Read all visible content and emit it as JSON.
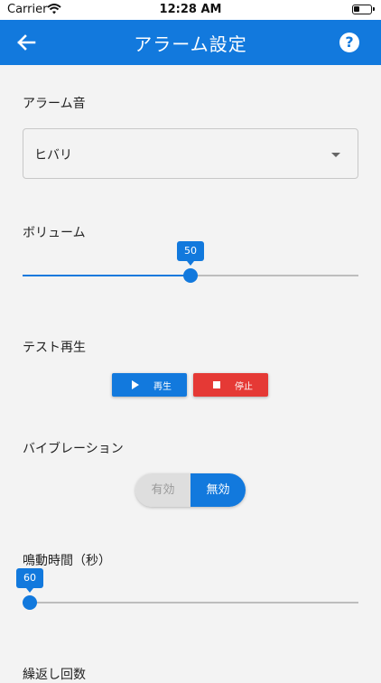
{
  "status_bar": {
    "carrier": "Carrier",
    "time": "12:28 AM"
  },
  "app_bar": {
    "title": "アラーム設定",
    "help": "?"
  },
  "alarm_sound": {
    "label": "アラーム音",
    "value": "ヒバリ"
  },
  "volume": {
    "label": "ボリューム",
    "value": 50,
    "value_text": "50",
    "min": 0,
    "max": 100
  },
  "test_play": {
    "label": "テスト再生",
    "play_label": "再生",
    "stop_label": "停止"
  },
  "vibration": {
    "label": "バイブレーション",
    "on_label": "有効",
    "off_label": "無効",
    "selected": "無効"
  },
  "ring_duration": {
    "label": "鳴動時間（秒）",
    "value": 60,
    "value_text": "60",
    "min": 60,
    "max": 600
  },
  "repeat_count": {
    "label": "繰返し回数"
  },
  "colors": {
    "primary": "#1279dd",
    "stop": "#e53935"
  }
}
